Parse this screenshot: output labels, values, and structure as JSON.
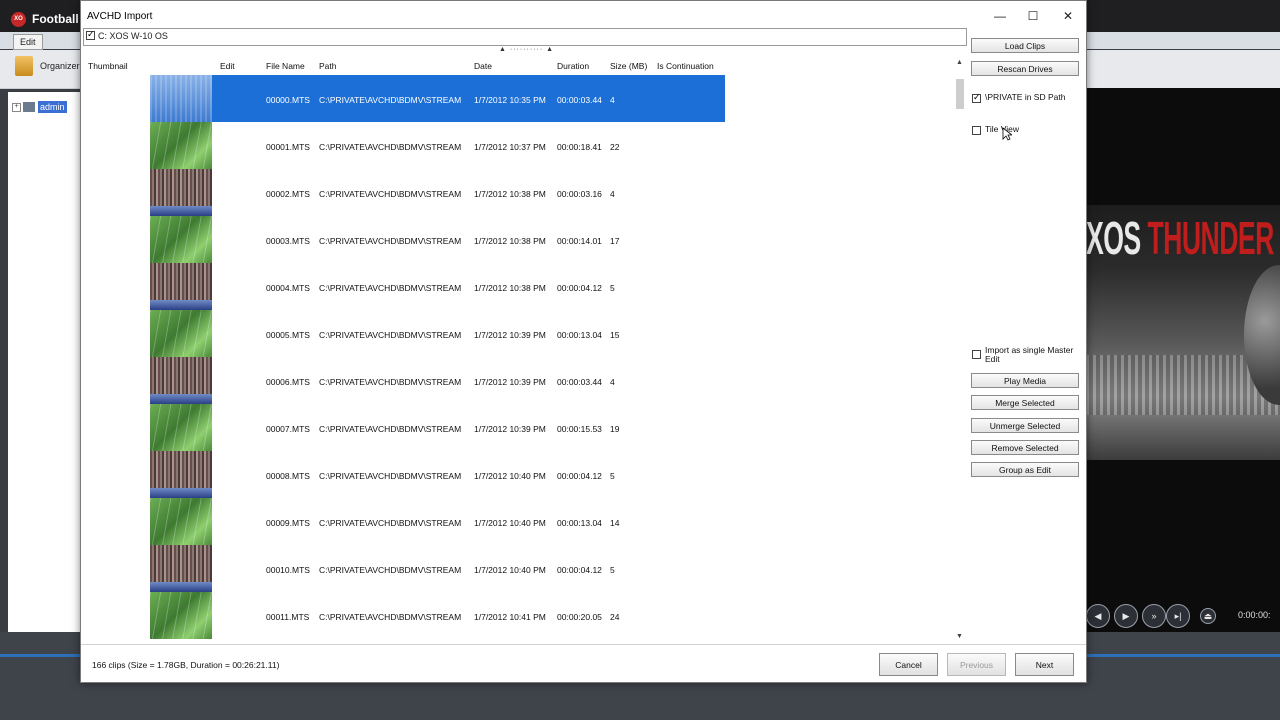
{
  "background_app": {
    "title": "Football",
    "menu_edit": "Edit",
    "toolbar_organizer": "Organizer",
    "tree_root": "admin",
    "hero_text_white": "XOS ",
    "hero_text_red": "THUNDER",
    "player_time": "0:00:00:"
  },
  "dialog": {
    "title": "AVCHD Import",
    "window_buttons": {
      "minimize": "—",
      "maximize": "☐",
      "close": "✕"
    },
    "drive": {
      "label": "C: XOS W-10 OS",
      "checked": true
    },
    "columns": {
      "thumbnail": "Thumbnail",
      "edit": "Edit",
      "file_name": "File Name",
      "path": "Path",
      "date": "Date",
      "duration": "Duration",
      "size": "Size (MB)",
      "is_continuation": "Is Continuation"
    },
    "rows": [
      {
        "file": "00000.MTS",
        "path": "C:\\PRIVATE\\AVCHD\\BDMV\\STREAM",
        "date": "1/7/2012 10:35 PM",
        "duration": "00:00:03.44",
        "size": "4",
        "thumb": "sel",
        "selected": true
      },
      {
        "file": "00001.MTS",
        "path": "C:\\PRIVATE\\AVCHD\\BDMV\\STREAM",
        "date": "1/7/2012 10:37 PM",
        "duration": "00:00:18.41",
        "size": "22",
        "thumb": "field"
      },
      {
        "file": "00002.MTS",
        "path": "C:\\PRIVATE\\AVCHD\\BDMV\\STREAM",
        "date": "1/7/2012 10:38 PM",
        "duration": "00:00:03.16",
        "size": "4",
        "thumb": "crowd"
      },
      {
        "file": "00003.MTS",
        "path": "C:\\PRIVATE\\AVCHD\\BDMV\\STREAM",
        "date": "1/7/2012 10:38 PM",
        "duration": "00:00:14.01",
        "size": "17",
        "thumb": "field"
      },
      {
        "file": "00004.MTS",
        "path": "C:\\PRIVATE\\AVCHD\\BDMV\\STREAM",
        "date": "1/7/2012 10:38 PM",
        "duration": "00:00:04.12",
        "size": "5",
        "thumb": "crowd"
      },
      {
        "file": "00005.MTS",
        "path": "C:\\PRIVATE\\AVCHD\\BDMV\\STREAM",
        "date": "1/7/2012 10:39 PM",
        "duration": "00:00:13.04",
        "size": "15",
        "thumb": "field"
      },
      {
        "file": "00006.MTS",
        "path": "C:\\PRIVATE\\AVCHD\\BDMV\\STREAM",
        "date": "1/7/2012 10:39 PM",
        "duration": "00:00:03.44",
        "size": "4",
        "thumb": "crowd"
      },
      {
        "file": "00007.MTS",
        "path": "C:\\PRIVATE\\AVCHD\\BDMV\\STREAM",
        "date": "1/7/2012 10:39 PM",
        "duration": "00:00:15.53",
        "size": "19",
        "thumb": "field"
      },
      {
        "file": "00008.MTS",
        "path": "C:\\PRIVATE\\AVCHD\\BDMV\\STREAM",
        "date": "1/7/2012 10:40 PM",
        "duration": "00:00:04.12",
        "size": "5",
        "thumb": "crowd"
      },
      {
        "file": "00009.MTS",
        "path": "C:\\PRIVATE\\AVCHD\\BDMV\\STREAM",
        "date": "1/7/2012 10:40 PM",
        "duration": "00:00:13.04",
        "size": "14",
        "thumb": "field"
      },
      {
        "file": "00010.MTS",
        "path": "C:\\PRIVATE\\AVCHD\\BDMV\\STREAM",
        "date": "1/7/2012 10:40 PM",
        "duration": "00:00:04.12",
        "size": "5",
        "thumb": "crowd"
      },
      {
        "file": "00011.MTS",
        "path": "C:\\PRIVATE\\AVCHD\\BDMV\\STREAM",
        "date": "1/7/2012 10:41 PM",
        "duration": "00:00:20.05",
        "size": "24",
        "thumb": "field"
      }
    ],
    "side": {
      "load_clips": "Load Clips",
      "rescan_drives": "Rescan Drives",
      "private_in_sd_path": "\\PRIVATE in SD Path",
      "private_in_sd_path_checked": true,
      "tile_view": "Tile View",
      "tile_view_checked": false,
      "import_single_master": "Import as single Master Edit",
      "import_single_master_checked": false,
      "play_media": "Play Media",
      "merge_selected": "Merge Selected",
      "unmerge_selected": "Unmerge Selected",
      "remove_selected": "Remove Selected",
      "group_as_edit": "Group as Edit"
    },
    "status": "166 clips (Size = 1.78GB, Duration = 00:26:21.11)",
    "footer": {
      "cancel": "Cancel",
      "previous": "Previous",
      "next": "Next"
    }
  }
}
